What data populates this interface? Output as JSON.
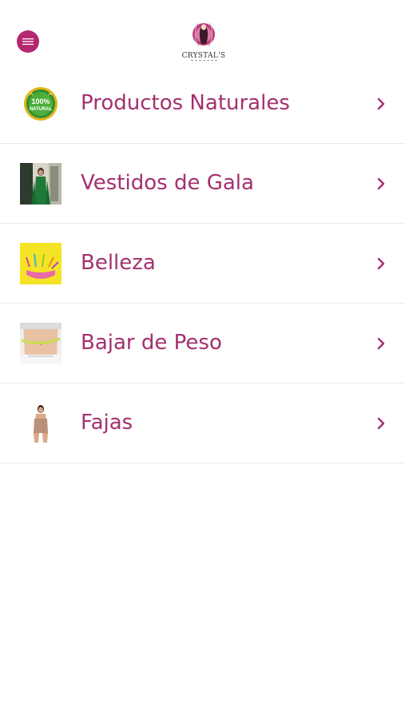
{
  "header": {
    "menu_icon": "menu-icon",
    "logo_name": "CRYSTAL'S",
    "accent_color": "#b3276f"
  },
  "categories": [
    {
      "label": "Productos Naturales",
      "icon": "natural-badge"
    },
    {
      "label": "Vestidos de Gala",
      "icon": "dress-photo"
    },
    {
      "label": "Belleza",
      "icon": "beauty-photo"
    },
    {
      "label": "Bajar de Peso",
      "icon": "waist-measure-photo"
    },
    {
      "label": "Fajas",
      "icon": "shapewear-photo"
    }
  ],
  "colors": {
    "label": "#a3306e",
    "chevron": "#a3306e",
    "divider": "#e8e8e8"
  }
}
